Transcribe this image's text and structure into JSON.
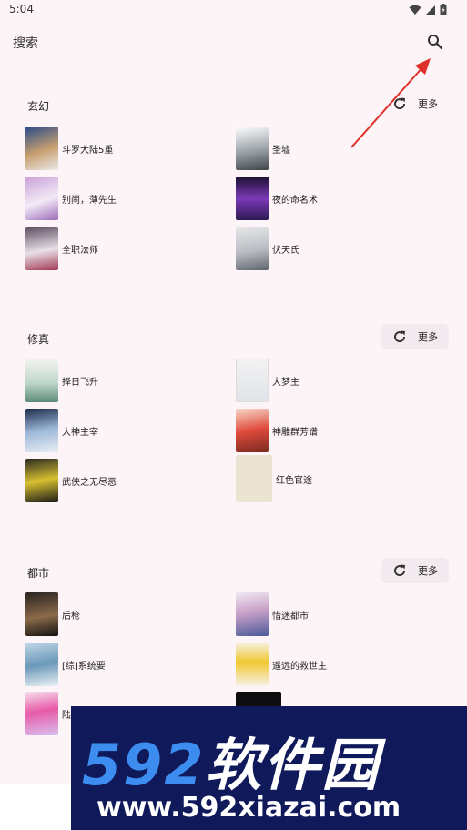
{
  "status_bar": {
    "time": "5:04"
  },
  "search": {
    "label": "搜索"
  },
  "sections": [
    {
      "title": "玄幻",
      "more": "更多",
      "books": [
        "斗罗大陆5重",
        "圣墟",
        "别闹，薄先生",
        "夜的命名术",
        "全职法师",
        "伏天氏"
      ]
    },
    {
      "title": "修真",
      "more": "更多",
      "books": [
        "择日飞升",
        "大梦主",
        "大神主宰",
        "神雕群芳谱",
        "武侠之无尽恶",
        "红色官途"
      ]
    },
    {
      "title": "都市",
      "more": "更多",
      "books": [
        "后枪",
        "惜迷都市",
        "[综]系统要",
        "遥远的救世主",
        "陆",
        ""
      ]
    }
  ],
  "watermark": {
    "logo_num": "592",
    "logo_text": "软件园",
    "url": "www.592xiazai.com"
  },
  "colors": {
    "background": "#fdf4f8",
    "arrow": "#e0302a",
    "watermark_bg": "#101a5b",
    "watermark_blue": "#3d8df0"
  }
}
